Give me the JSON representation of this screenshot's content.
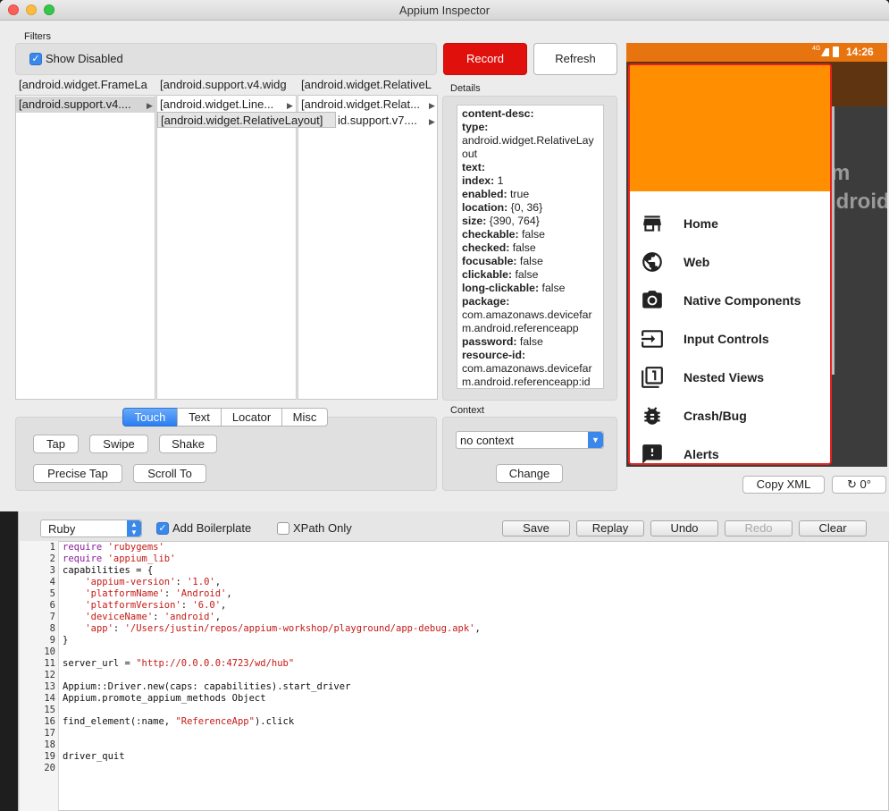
{
  "window": {
    "title": "Appium Inspector"
  },
  "filters": {
    "label": "Filters",
    "show_disabled_label": "Show Disabled",
    "show_disabled_checked": true
  },
  "columns": [
    {
      "header": "[android.widget.FrameLa",
      "rows": [
        "[android.support.v4...."
      ]
    },
    {
      "header": "[android.support.v4.widg",
      "rows": [
        "[android.widget.Line...",
        "[android.widget.RelativeLayout]"
      ]
    },
    {
      "header": "[android.widget.RelativeL",
      "rows": [
        "[android.widget.Relat...",
        "id.support.v7...."
      ]
    }
  ],
  "buttons": {
    "record": "Record",
    "refresh": "Refresh",
    "change": "Change",
    "copy_xml": "Copy XML",
    "rotate": "0°"
  },
  "details": {
    "label": "Details",
    "fields": [
      {
        "key": "content-desc:",
        "value": ""
      },
      {
        "key": "type:",
        "value": ""
      },
      {
        "key": "",
        "value": "android.widget.RelativeLay"
      },
      {
        "key": "",
        "value": "out"
      },
      {
        "key": "text:",
        "value": ""
      },
      {
        "key": "index:",
        "value": " 1"
      },
      {
        "key": "enabled:",
        "value": " true"
      },
      {
        "key": "location:",
        "value": " {0, 36}"
      },
      {
        "key": "size:",
        "value": " {390, 764}"
      },
      {
        "key": "checkable:",
        "value": " false"
      },
      {
        "key": "checked:",
        "value": " false"
      },
      {
        "key": "focusable:",
        "value": " false"
      },
      {
        "key": "clickable:",
        "value": " false"
      },
      {
        "key": "long-clickable:",
        "value": " false"
      },
      {
        "key": "package:",
        "value": ""
      },
      {
        "key": "",
        "value": "com.amazonaws.devicefar"
      },
      {
        "key": "",
        "value": "m.android.referenceapp"
      },
      {
        "key": "password:",
        "value": " false"
      },
      {
        "key": "resource-id:",
        "value": ""
      },
      {
        "key": "",
        "value": "com.amazonaws.devicefar"
      },
      {
        "key": "",
        "value": "m.android.referenceapp:id"
      }
    ]
  },
  "action_tabs": [
    "Touch",
    "Text",
    "Locator",
    "Misc"
  ],
  "touch_actions": [
    "Tap",
    "Swipe",
    "Shake",
    "Precise Tap",
    "Scroll To"
  ],
  "context": {
    "label": "Context",
    "value": "no context"
  },
  "phone": {
    "status_time": "14:26",
    "status_icons": "4G",
    "background_text": [
      "m",
      "ndroid"
    ],
    "drawer_color": "#ff8f00",
    "nav_items": [
      {
        "label": "Home",
        "icon": "store-icon"
      },
      {
        "label": "Web",
        "icon": "globe-icon"
      },
      {
        "label": "Native Components",
        "icon": "camera-icon"
      },
      {
        "label": "Input Controls",
        "icon": "input-icon"
      },
      {
        "label": "Nested Views",
        "icon": "filter-one-icon"
      },
      {
        "label": "Crash/Bug",
        "icon": "bug-icon"
      },
      {
        "label": "Alerts",
        "icon": "alert-icon"
      }
    ]
  },
  "editor": {
    "language": "Ruby",
    "add_boilerplate_label": "Add Boilerplate",
    "add_boilerplate_checked": true,
    "xpath_only_label": "XPath Only",
    "xpath_only_checked": false,
    "toolbar": [
      "Save",
      "Replay",
      "Undo",
      "Redo",
      "Clear"
    ],
    "lines": [
      "require 'rubygems'",
      "require 'appium_lib'",
      "capabilities = {",
      "    'appium-version': '1.0',",
      "    'platformName': 'Android',",
      "    'platformVersion': '6.0',",
      "    'deviceName': 'android',",
      "    'app': '/Users/justin/repos/appium-workshop/playground/app-debug.apk',",
      "}",
      "",
      "server_url = \"http://0.0.0.0:4723/wd/hub\"",
      "",
      "Appium::Driver.new(caps: capabilities).start_driver",
      "Appium.promote_appium_methods Object",
      "",
      "find_element(:name, \"ReferenceApp\").click",
      "",
      "",
      "driver_quit",
      ""
    ]
  }
}
